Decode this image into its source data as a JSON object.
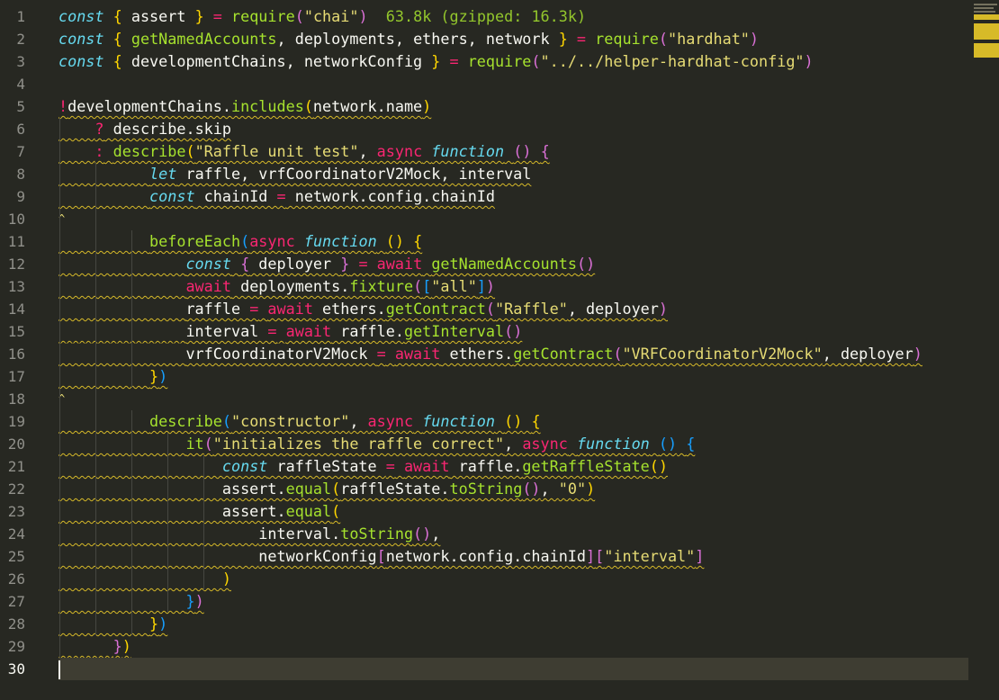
{
  "editor": {
    "current_line": 30,
    "import_cost_hint": "63.8k (gzipped: 16.3k)",
    "lines": [
      {
        "n": "1",
        "tokens": [
          [
            "const",
            "k"
          ],
          [
            " ",
            "id"
          ],
          [
            "{",
            "b1"
          ],
          [
            " assert ",
            "id"
          ],
          [
            "}",
            "b1"
          ],
          [
            " = ",
            "op"
          ],
          [
            "require",
            "f"
          ],
          [
            "(",
            "b2"
          ],
          [
            "\"chai\"",
            "s"
          ],
          [
            ")",
            "b2"
          ]
        ]
      },
      {
        "n": "2",
        "tokens": [
          [
            "const",
            "k"
          ],
          [
            " ",
            "id"
          ],
          [
            "{",
            "b1"
          ],
          [
            " ",
            "id"
          ],
          [
            "getNamedAccounts",
            "f"
          ],
          [
            ", deployments, ethers, network ",
            "id"
          ],
          [
            "}",
            "b1"
          ],
          [
            " = ",
            "op"
          ],
          [
            "require",
            "f"
          ],
          [
            "(",
            "b2"
          ],
          [
            "\"hardhat\"",
            "s"
          ],
          [
            ")",
            "b2"
          ]
        ]
      },
      {
        "n": "3",
        "tokens": [
          [
            "const",
            "k"
          ],
          [
            " ",
            "id"
          ],
          [
            "{",
            "b1"
          ],
          [
            " developmentChains, networkConfig ",
            "id"
          ],
          [
            "}",
            "b1"
          ],
          [
            " = ",
            "op"
          ],
          [
            "require",
            "f"
          ],
          [
            "(",
            "b2"
          ],
          [
            "\"../../helper-hardhat-config\"",
            "s"
          ],
          [
            ")",
            "b2"
          ]
        ]
      },
      {
        "n": "4",
        "tokens": []
      },
      {
        "n": "5",
        "tokens": [
          [
            "!",
            "op"
          ],
          [
            "developmentChains.",
            "id"
          ],
          [
            "includes",
            "f"
          ],
          [
            "(",
            "b1"
          ],
          [
            "network.name",
            "id"
          ],
          [
            ")",
            "b1"
          ]
        ]
      },
      {
        "n": "6",
        "tokens": [
          [
            "    ",
            "id"
          ],
          [
            "?",
            "op"
          ],
          [
            " describe.skip",
            "id"
          ]
        ]
      },
      {
        "n": "7",
        "tokens": [
          [
            "    ",
            "id"
          ],
          [
            ":",
            "op"
          ],
          [
            " ",
            "id"
          ],
          [
            "describe",
            "f"
          ],
          [
            "(",
            "b1"
          ],
          [
            "\"Raffle unit test\"",
            "s"
          ],
          [
            ", ",
            "id"
          ],
          [
            "async",
            "op"
          ],
          [
            " ",
            "id"
          ],
          [
            "function",
            "k"
          ],
          [
            " ",
            "id"
          ],
          [
            "()",
            "b2"
          ],
          [
            " ",
            "id"
          ],
          [
            "{",
            "b2"
          ]
        ]
      },
      {
        "n": "8",
        "tokens": [
          [
            "          ",
            "id"
          ],
          [
            "let",
            "k"
          ],
          [
            " raffle, vrfCoordinatorV2Mock, interval",
            "id"
          ]
        ]
      },
      {
        "n": "9",
        "tokens": [
          [
            "          ",
            "id"
          ],
          [
            "const",
            "k"
          ],
          [
            " chainId ",
            "id"
          ],
          [
            "=",
            "op"
          ],
          [
            " network.config.chainId",
            "id"
          ]
        ]
      },
      {
        "n": "10",
        "tokens": []
      },
      {
        "n": "11",
        "tokens": [
          [
            "          ",
            "id"
          ],
          [
            "beforeEach",
            "f"
          ],
          [
            "(",
            "b3"
          ],
          [
            "async",
            "op"
          ],
          [
            " ",
            "id"
          ],
          [
            "function",
            "k"
          ],
          [
            " ",
            "id"
          ],
          [
            "()",
            "b1"
          ],
          [
            " ",
            "id"
          ],
          [
            "{",
            "b1"
          ]
        ]
      },
      {
        "n": "12",
        "tokens": [
          [
            "              ",
            "id"
          ],
          [
            "const",
            "k"
          ],
          [
            " ",
            "id"
          ],
          [
            "{",
            "b2"
          ],
          [
            " deployer ",
            "id"
          ],
          [
            "}",
            "b2"
          ],
          [
            " = ",
            "op"
          ],
          [
            "await",
            "op"
          ],
          [
            " ",
            "id"
          ],
          [
            "getNamedAccounts",
            "f"
          ],
          [
            "()",
            "b2"
          ]
        ]
      },
      {
        "n": "13",
        "tokens": [
          [
            "              ",
            "id"
          ],
          [
            "await",
            "op"
          ],
          [
            " deployments.",
            "id"
          ],
          [
            "fixture",
            "f"
          ],
          [
            "(",
            "b2"
          ],
          [
            "[",
            "b3"
          ],
          [
            "\"all\"",
            "s"
          ],
          [
            "]",
            "b3"
          ],
          [
            ")",
            "b2"
          ]
        ]
      },
      {
        "n": "14",
        "tokens": [
          [
            "              ",
            "id"
          ],
          [
            "raffle ",
            "id"
          ],
          [
            "=",
            "op"
          ],
          [
            " ",
            "id"
          ],
          [
            "await",
            "op"
          ],
          [
            " ethers.",
            "id"
          ],
          [
            "getContract",
            "f"
          ],
          [
            "(",
            "b2"
          ],
          [
            "\"Raffle\"",
            "s"
          ],
          [
            ", deployer",
            "id"
          ],
          [
            ")",
            "b2"
          ]
        ]
      },
      {
        "n": "15",
        "tokens": [
          [
            "              ",
            "id"
          ],
          [
            "interval ",
            "id"
          ],
          [
            "=",
            "op"
          ],
          [
            " ",
            "id"
          ],
          [
            "await",
            "op"
          ],
          [
            " raffle.",
            "id"
          ],
          [
            "getInterval",
            "f"
          ],
          [
            "()",
            "b2"
          ]
        ]
      },
      {
        "n": "16",
        "tokens": [
          [
            "              ",
            "id"
          ],
          [
            "vrfCoordinatorV2Mock ",
            "id"
          ],
          [
            "=",
            "op"
          ],
          [
            " ",
            "id"
          ],
          [
            "await",
            "op"
          ],
          [
            " ethers.",
            "id"
          ],
          [
            "getContract",
            "f"
          ],
          [
            "(",
            "b2"
          ],
          [
            "\"VRFCoordinatorV2Mock\"",
            "s"
          ],
          [
            ", deployer",
            "id"
          ],
          [
            ")",
            "b2"
          ]
        ]
      },
      {
        "n": "17",
        "tokens": [
          [
            "          ",
            "id"
          ],
          [
            "}",
            "b1"
          ],
          [
            ")",
            "b3"
          ]
        ]
      },
      {
        "n": "18",
        "tokens": []
      },
      {
        "n": "19",
        "tokens": [
          [
            "          ",
            "id"
          ],
          [
            "describe",
            "f"
          ],
          [
            "(",
            "b3"
          ],
          [
            "\"constructor\"",
            "s"
          ],
          [
            ", ",
            "id"
          ],
          [
            "async",
            "op"
          ],
          [
            " ",
            "id"
          ],
          [
            "function",
            "k"
          ],
          [
            " ",
            "id"
          ],
          [
            "()",
            "b1"
          ],
          [
            " ",
            "id"
          ],
          [
            "{",
            "b1"
          ]
        ]
      },
      {
        "n": "20",
        "tokens": [
          [
            "              ",
            "id"
          ],
          [
            "it",
            "f"
          ],
          [
            "(",
            "b2"
          ],
          [
            "\"initializes the raffle correct\"",
            "s"
          ],
          [
            ", ",
            "id"
          ],
          [
            "async",
            "op"
          ],
          [
            " ",
            "id"
          ],
          [
            "function",
            "k"
          ],
          [
            " ",
            "id"
          ],
          [
            "()",
            "b3"
          ],
          [
            " ",
            "id"
          ],
          [
            "{",
            "b3"
          ]
        ]
      },
      {
        "n": "21",
        "tokens": [
          [
            "                  ",
            "id"
          ],
          [
            "const",
            "k"
          ],
          [
            " raffleState ",
            "id"
          ],
          [
            "=",
            "op"
          ],
          [
            " ",
            "id"
          ],
          [
            "await",
            "op"
          ],
          [
            " raffle.",
            "id"
          ],
          [
            "getRaffleState",
            "f"
          ],
          [
            "()",
            "b1"
          ]
        ]
      },
      {
        "n": "22",
        "tokens": [
          [
            "                  ",
            "id"
          ],
          [
            "assert.",
            "id"
          ],
          [
            "equal",
            "f"
          ],
          [
            "(",
            "b1"
          ],
          [
            "raffleState.",
            "id"
          ],
          [
            "toString",
            "f"
          ],
          [
            "()",
            "b2"
          ],
          [
            ", ",
            "id"
          ],
          [
            "\"0\"",
            "s"
          ],
          [
            ")",
            "b1"
          ]
        ]
      },
      {
        "n": "23",
        "tokens": [
          [
            "                  ",
            "id"
          ],
          [
            "assert.",
            "id"
          ],
          [
            "equal",
            "f"
          ],
          [
            "(",
            "b1"
          ]
        ]
      },
      {
        "n": "24",
        "tokens": [
          [
            "                      ",
            "id"
          ],
          [
            "interval.",
            "id"
          ],
          [
            "toString",
            "f"
          ],
          [
            "()",
            "b2"
          ],
          [
            ",",
            "id"
          ]
        ]
      },
      {
        "n": "25",
        "tokens": [
          [
            "                      ",
            "id"
          ],
          [
            "networkConfig",
            "id"
          ],
          [
            "[",
            "b2"
          ],
          [
            "network.config.chainId",
            "id"
          ],
          [
            "]",
            "b2"
          ],
          [
            "[",
            "b2"
          ],
          [
            "\"interval\"",
            "s"
          ],
          [
            "]",
            "b2"
          ]
        ]
      },
      {
        "n": "26",
        "tokens": [
          [
            "                  ",
            "id"
          ],
          [
            ")",
            "b1"
          ]
        ]
      },
      {
        "n": "27",
        "tokens": [
          [
            "              ",
            "id"
          ],
          [
            "}",
            "b3"
          ],
          [
            ")",
            "b2"
          ]
        ]
      },
      {
        "n": "28",
        "tokens": [
          [
            "          ",
            "id"
          ],
          [
            "}",
            "b1"
          ],
          [
            ")",
            "b3"
          ]
        ]
      },
      {
        "n": "29",
        "tokens": [
          [
            "      ",
            "id"
          ],
          [
            "}",
            "b2"
          ],
          [
            ")",
            "b1"
          ]
        ]
      },
      {
        "n": "30",
        "tokens": []
      }
    ]
  },
  "colors": {
    "background": "#272822",
    "current_line": "#3e3d32",
    "squiggle": "#d7ba28"
  }
}
